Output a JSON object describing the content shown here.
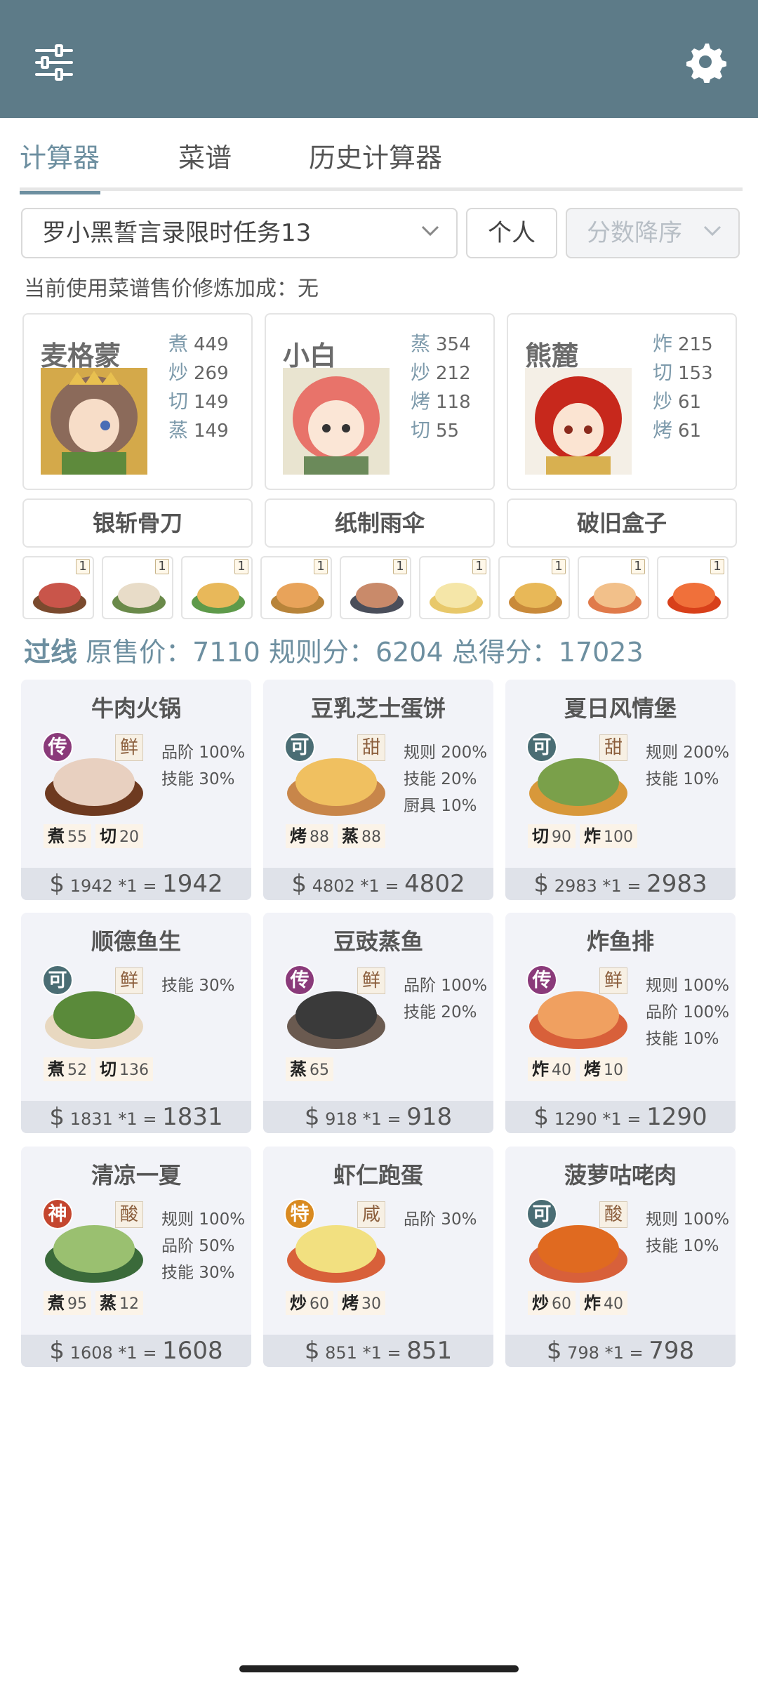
{
  "colors": {
    "topbar": "#5d7b88",
    "accent": "#6d8fa0"
  },
  "topbar": {
    "left_icon": "sliders-icon",
    "right_icon": "gear-icon"
  },
  "tabs": [
    {
      "label": "计算器",
      "active": true
    },
    {
      "label": "菜谱",
      "active": false
    },
    {
      "label": "历史计算器",
      "active": false
    }
  ],
  "controls": {
    "task_select": "罗小黑誓言录限时任务13",
    "scope": "个人",
    "sort": "分数降序",
    "bonus_text": "当前使用菜谱售价修炼加成：无"
  },
  "chefs": [
    {
      "name": "麦格蒙",
      "skills": [
        {
          "k": "煮",
          "v": "449"
        },
        {
          "k": "炒",
          "v": "269"
        },
        {
          "k": "切",
          "v": "149"
        },
        {
          "k": "蒸",
          "v": "149"
        }
      ],
      "equip": "银斩骨刀"
    },
    {
      "name": "小白",
      "skills": [
        {
          "k": "蒸",
          "v": "354"
        },
        {
          "k": "炒",
          "v": "212"
        },
        {
          "k": "烤",
          "v": "118"
        },
        {
          "k": "切",
          "v": "55"
        }
      ],
      "equip": "纸制雨伞"
    },
    {
      "name": "熊麓",
      "skills": [
        {
          "k": "炸",
          "v": "215"
        },
        {
          "k": "切",
          "v": "153"
        },
        {
          "k": "炒",
          "v": "61"
        },
        {
          "k": "烤",
          "v": "61"
        }
      ],
      "equip": "破旧盒子"
    }
  ],
  "mini_dishes": [
    {
      "qty": "1"
    },
    {
      "qty": "1"
    },
    {
      "qty": "1"
    },
    {
      "qty": "1"
    },
    {
      "qty": "1"
    },
    {
      "qty": "1"
    },
    {
      "qty": "1"
    },
    {
      "qty": "1"
    },
    {
      "qty": "1"
    }
  ],
  "summary": {
    "pass": "过线",
    "orig_label": "原售价：",
    "orig": "7110",
    "rule_label": "规则分：",
    "rule": "6204",
    "total_label": "总得分：",
    "total": "17023"
  },
  "dishes": [
    {
      "name": "牛肉火锅",
      "rarity": "传",
      "flavor": "鲜",
      "buffs": [
        "品阶 100%",
        "技能 30%"
      ],
      "reqs": [
        {
          "k": "煮",
          "v": "55"
        },
        {
          "k": "切",
          "v": "20"
        }
      ],
      "price": "1942",
      "mult": "*1",
      "total": "1942"
    },
    {
      "name": "豆乳芝士蛋饼",
      "rarity": "可",
      "flavor": "甜",
      "buffs": [
        "规则 200%",
        "技能 20%",
        "厨具 10%"
      ],
      "reqs": [
        {
          "k": "烤",
          "v": "88"
        },
        {
          "k": "蒸",
          "v": "88"
        }
      ],
      "price": "4802",
      "mult": "*1",
      "total": "4802"
    },
    {
      "name": "夏日风情堡",
      "rarity": "可",
      "flavor": "甜",
      "buffs": [
        "规则 200%",
        "技能 10%"
      ],
      "reqs": [
        {
          "k": "切",
          "v": "90"
        },
        {
          "k": "炸",
          "v": "100"
        }
      ],
      "price": "2983",
      "mult": "*1",
      "total": "2983"
    },
    {
      "name": "顺德鱼生",
      "rarity": "可",
      "flavor": "鲜",
      "buffs": [
        "技能 30%"
      ],
      "reqs": [
        {
          "k": "煮",
          "v": "52"
        },
        {
          "k": "切",
          "v": "136"
        }
      ],
      "price": "1831",
      "mult": "*1",
      "total": "1831"
    },
    {
      "name": "豆豉蒸鱼",
      "rarity": "传",
      "flavor": "鲜",
      "buffs": [
        "品阶 100%",
        "技能 20%"
      ],
      "reqs": [
        {
          "k": "蒸",
          "v": "65"
        }
      ],
      "price": "918",
      "mult": "*1",
      "total": "918"
    },
    {
      "name": "炸鱼排",
      "rarity": "传",
      "flavor": "鲜",
      "buffs": [
        "规则 100%",
        "品阶 100%",
        "技能 10%"
      ],
      "reqs": [
        {
          "k": "炸",
          "v": "40"
        },
        {
          "k": "烤",
          "v": "10"
        }
      ],
      "price": "1290",
      "mult": "*1",
      "total": "1290"
    },
    {
      "name": "清凉一夏",
      "rarity": "神",
      "flavor": "酸",
      "buffs": [
        "规则 100%",
        "品阶 50%",
        "技能 30%"
      ],
      "reqs": [
        {
          "k": "煮",
          "v": "95"
        },
        {
          "k": "蒸",
          "v": "12"
        }
      ],
      "price": "1608",
      "mult": "*1",
      "total": "1608"
    },
    {
      "name": "虾仁跑蛋",
      "rarity": "特",
      "flavor": "咸",
      "buffs": [
        "品阶 30%"
      ],
      "reqs": [
        {
          "k": "炒",
          "v": "60"
        },
        {
          "k": "烤",
          "v": "30"
        }
      ],
      "price": "851",
      "mult": "*1",
      "total": "851"
    },
    {
      "name": "菠萝咕咾肉",
      "rarity": "可",
      "flavor": "酸",
      "buffs": [
        "规则 100%",
        "技能 10%"
      ],
      "reqs": [
        {
          "k": "炒",
          "v": "60"
        },
        {
          "k": "炸",
          "v": "40"
        }
      ],
      "price": "798",
      "mult": "*1",
      "total": "798"
    }
  ],
  "rarity_colors": {
    "传": "#8a3a7a",
    "可": "#4a6d74",
    "神": "#c4462f",
    "特": "#d98a20"
  }
}
